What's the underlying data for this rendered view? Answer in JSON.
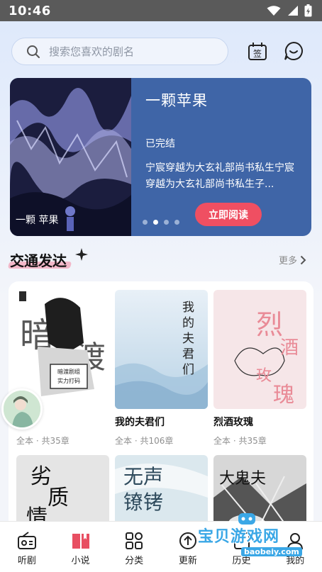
{
  "status_bar": {
    "time": "10:46"
  },
  "search": {
    "placeholder": "搜索您喜欢的剧名"
  },
  "header_icons": [
    "checkin-icon",
    "message-icon"
  ],
  "banner": {
    "cover_author_text": "一颗\n苹果",
    "title": "一颗苹果",
    "status": "已完结",
    "description": "宁宸穿越为大玄礼部尚书私生宁宸穿越为大玄礼部尚书私生子...",
    "button": "立即阅读",
    "dots_total": 4,
    "dots_active": 1
  },
  "section": {
    "title": "交通发达",
    "more": "更多"
  },
  "books": [
    {
      "name": "",
      "meta": "全本 · 共35章",
      "cover_text": "暗渡剧组 实力打码"
    },
    {
      "name": "我的夫君们",
      "meta": "全本 · 共106章",
      "cover_text": "我的夫君们"
    },
    {
      "name": "烈酒玫瑰",
      "meta": "全本 · 共35章",
      "cover_text": "烈酒玫瑰"
    },
    {
      "name": "",
      "meta": "",
      "cover_text": "劣质情"
    },
    {
      "name": "",
      "meta": "",
      "cover_text": "无声镣铐"
    },
    {
      "name": "",
      "meta": "",
      "cover_text": "大鬼夫"
    }
  ],
  "nav": [
    {
      "label": "听剧",
      "icon": "radio-icon"
    },
    {
      "label": "小说",
      "icon": "book-icon"
    },
    {
      "label": "分类",
      "icon": "grid-icon"
    },
    {
      "label": "更新",
      "icon": "update-icon"
    },
    {
      "label": "历史",
      "icon": "history-icon"
    },
    {
      "label": "我的",
      "icon": "profile-icon"
    }
  ],
  "watermark": {
    "text": "宝贝游戏网",
    "url": "baobeiy.com"
  },
  "colors": {
    "banner_bg": "#3f65a7",
    "button": "#ef4f62",
    "accent_pink": "#f2b8c9"
  }
}
